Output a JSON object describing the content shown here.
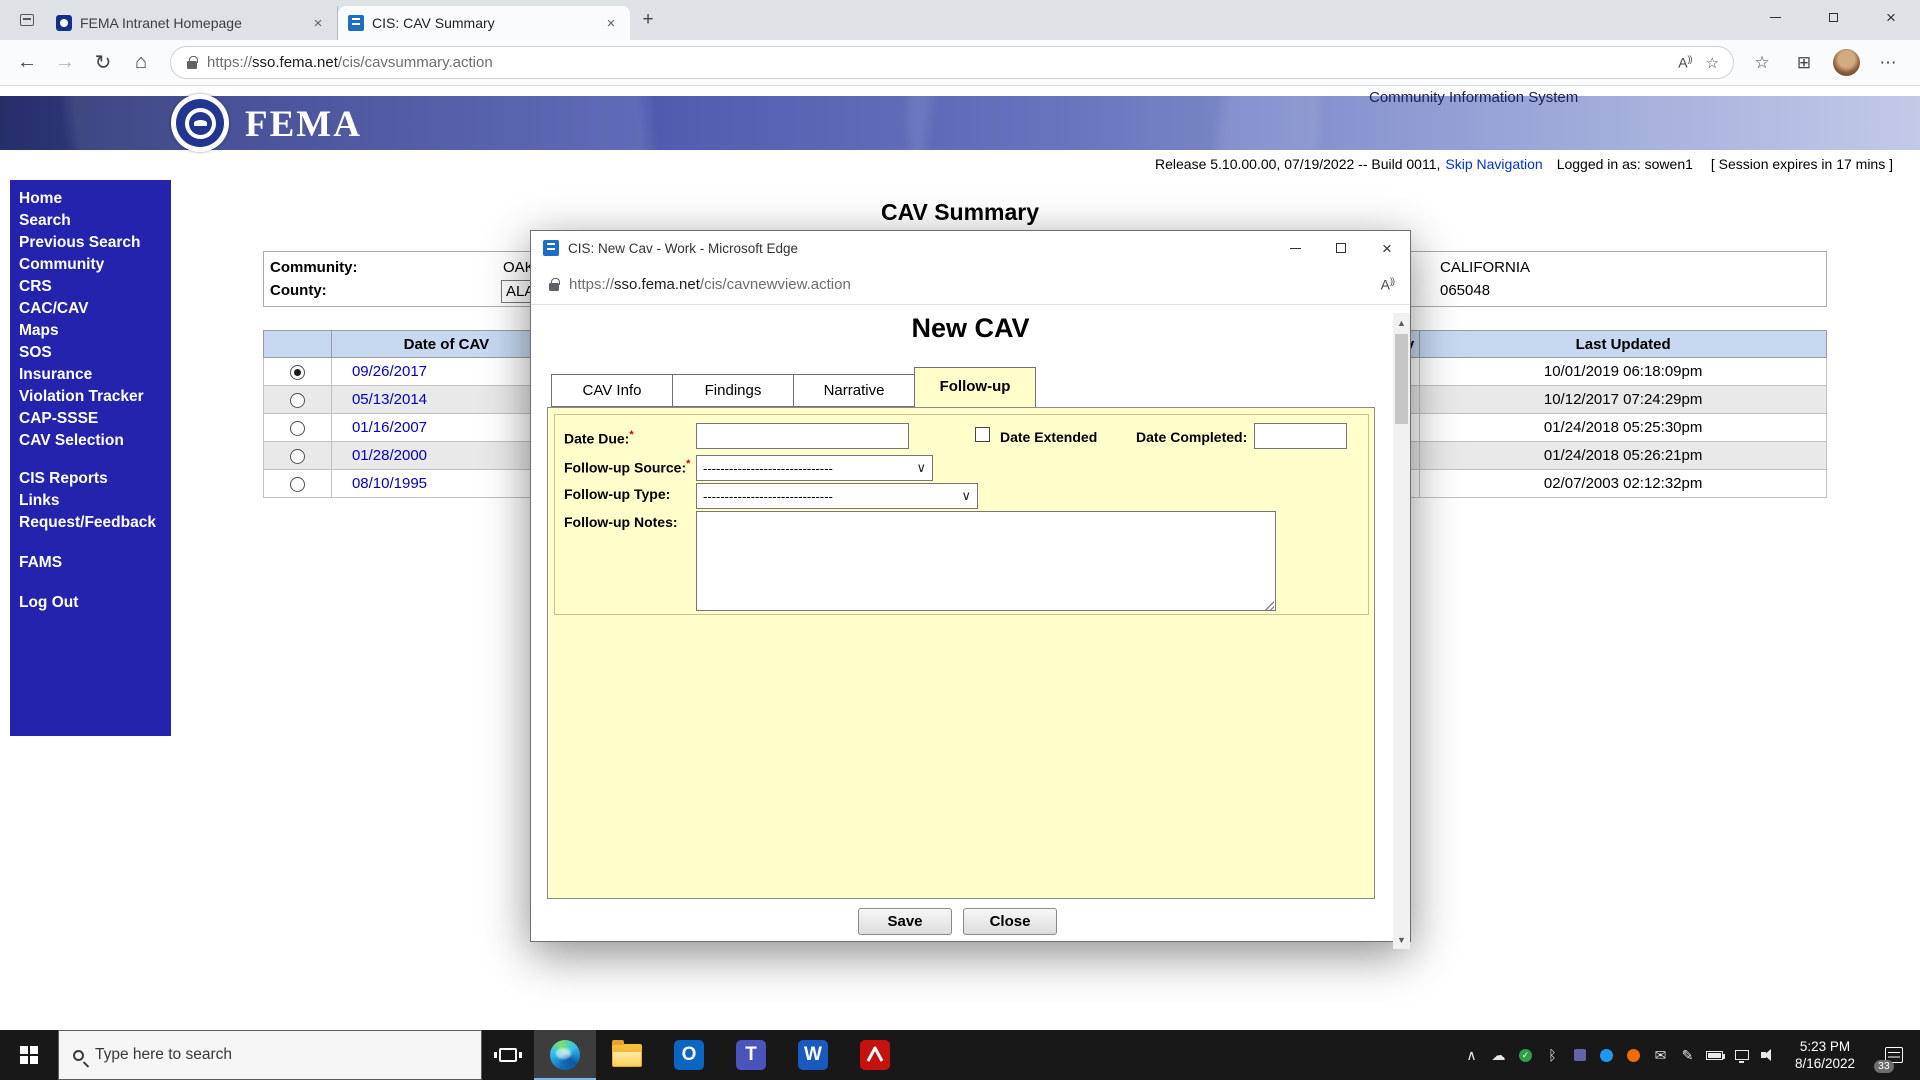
{
  "browser": {
    "tabs": [
      {
        "title": "FEMA Intranet Homepage"
      },
      {
        "title": "CIS: CAV Summary"
      }
    ],
    "url": {
      "scheme": "https://",
      "host": "sso.fema.net",
      "path": "/cis/cavsummary.action"
    }
  },
  "header": {
    "brand": "FEMA",
    "app_title": "Community Information System",
    "release_text": "Release 5.10.00.00, 07/19/2022 -- Build 0011,",
    "skip_nav": "Skip Navigation",
    "logged_in": "Logged in as: sowen1",
    "session": "[ Session expires in 17 mins ]"
  },
  "sidebar": {
    "items": [
      "Home",
      "Search",
      "Previous Search",
      "Community",
      "CRS",
      "CAC/CAV",
      "Maps",
      "SOS",
      "Insurance",
      "Violation Tracker",
      "CAP-SSSE",
      "CAV Selection",
      "CIS Reports",
      "Links",
      "Request/Feedback",
      "FAMS",
      "Log Out"
    ]
  },
  "main": {
    "title": "CAV Summary",
    "community_label": "Community:",
    "community_value": "OAK",
    "county_label": "County:",
    "county_value": "ALA",
    "state": "CALIFORNIA",
    "community_id": "065048",
    "table": {
      "col_date": "Date of CAV",
      "col_partial": "y",
      "col_updated": "Last Updated",
      "rows": [
        {
          "date": "09/26/2017",
          "updated": "10/01/2019 06:18:09pm"
        },
        {
          "date": "05/13/2014",
          "updated": "10/12/2017 07:24:29pm"
        },
        {
          "date": "01/16/2007",
          "updated": "01/24/2018 05:25:30pm"
        },
        {
          "date": "01/28/2000",
          "updated": "01/24/2018 05:26:21pm"
        },
        {
          "date": "08/10/1995",
          "updated": "02/07/2003 02:12:32pm"
        }
      ]
    }
  },
  "dialog": {
    "title": "CIS: New Cav - Work - Microsoft Edge",
    "url": {
      "scheme": "https://",
      "host": "sso.fema.net",
      "path": "/cis/cavnewview.action"
    },
    "heading": "New CAV",
    "tabs": [
      "CAV Info",
      "Findings",
      "Narrative",
      "Follow-up"
    ],
    "fields": {
      "date_due": "Date Due:",
      "required_mark": "*",
      "date_extended": "Date Extended",
      "date_completed": "Date Completed:",
      "source": "Follow-up Source:",
      "type": "Follow-up Type:",
      "notes": "Follow-up Notes:",
      "select_value": "------------------------------"
    },
    "save": "Save",
    "close": "Close"
  },
  "taskbar": {
    "search_placeholder": "Type here to search",
    "time": "5:23 PM",
    "date": "8/16/2022",
    "badge": "33"
  },
  "icons": {
    "back": "←",
    "forward": "→",
    "refresh": "↻",
    "home": "⌂",
    "new_tab": "+",
    "close": "×",
    "more": "⋯",
    "star": "☆",
    "collections": "⊞",
    "read_aloud_a": "A",
    "read_aloud_waves": "))",
    "select_arrow": "∨",
    "scroll_up": "▲",
    "scroll_down": "▼",
    "chevron_up": "∧",
    "cloud": "☁",
    "bluetooth": "ᛒ",
    "pen": "✎",
    "check": "✓",
    "envelope": "✉",
    "letter_o": "O",
    "letter_t": "T",
    "letter_w": "W"
  }
}
